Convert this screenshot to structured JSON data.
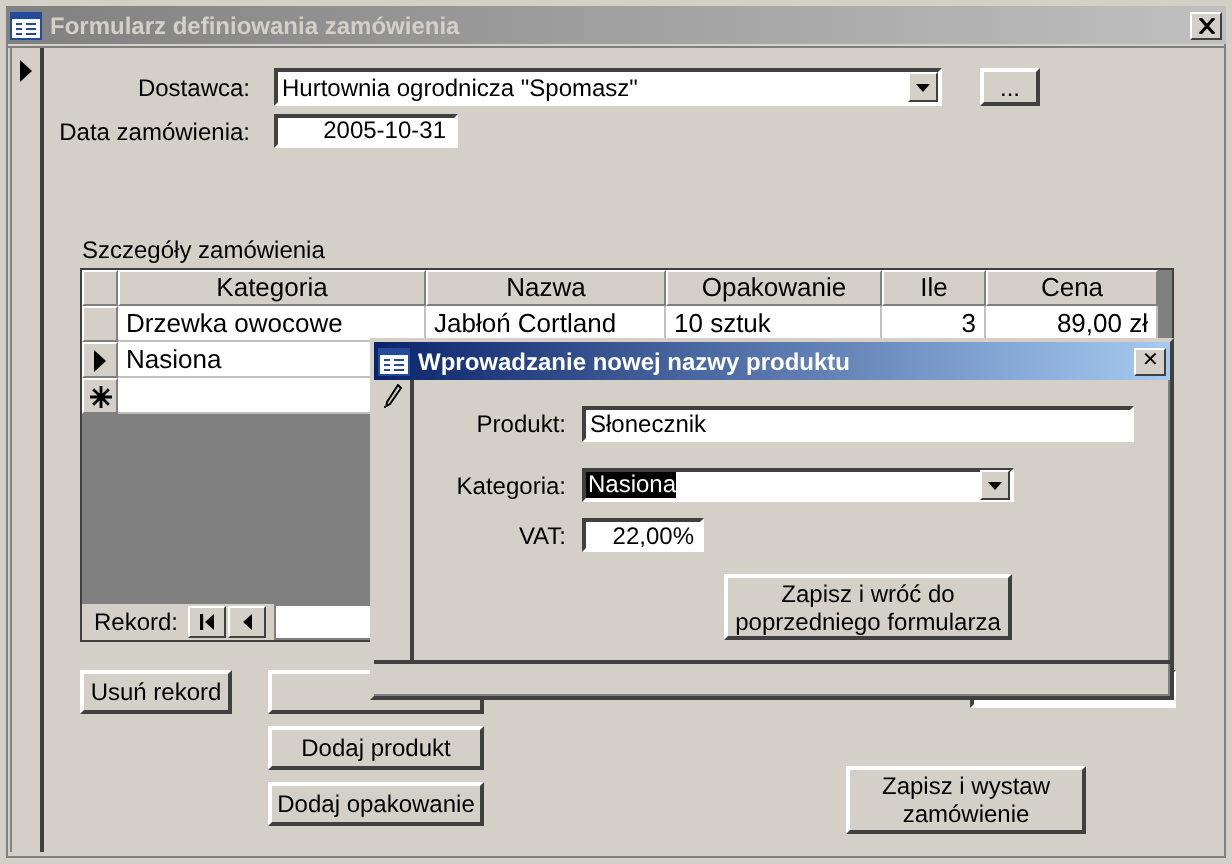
{
  "window": {
    "title": "Formularz definiowania zamówienia"
  },
  "form": {
    "current_record": true,
    "fields": [
      {
        "kind": "combo",
        "label": "Dostawca:",
        "value": "Hurtownia ogrodnicza \"Spomasz\""
      },
      {
        "kind": "date",
        "label": "Data zamówienia:",
        "value": "2005-10-31"
      }
    ],
    "browse_button": "...",
    "subform": {
      "title": "Szczegóły zamówienia",
      "columns": [
        "Kategoria",
        "Nazwa",
        "Opakowanie",
        "Ile",
        "Cena"
      ],
      "rows": [
        {
          "current": false,
          "new": false,
          "cells": [
            "Drzewka owocowe",
            "Jabłoń Cortland",
            "10 sztuk",
            "3",
            "89,00 zł"
          ]
        },
        {
          "current": true,
          "new": false,
          "cells": [
            "Nasiona"
          ]
        },
        {
          "current": false,
          "new": true,
          "cells": []
        }
      ],
      "navigator": {
        "label": "Rekord:"
      }
    },
    "record_buttons": [
      "Usuń rekord"
    ],
    "add_buttons": [
      "Dodaj produkt",
      "Dodaj opakowanie"
    ],
    "submit_button": "Zapisz i wystaw zamówienie"
  },
  "dialog": {
    "title": "Wprowadzanie nowej nazwy produktu",
    "close": "✕",
    "fields": [
      {
        "kind": "text",
        "label": "Produkt:",
        "value": "Słonecznik",
        "highlighted": false
      },
      {
        "kind": "combo",
        "label": "Kategoria:",
        "value": "Nasiona",
        "highlighted": true
      },
      {
        "kind": "number",
        "label": "VAT:",
        "value": "22,00%",
        "highlighted": false
      }
    ],
    "button": "Zapisz i wróć do poprzedniego formularza"
  }
}
